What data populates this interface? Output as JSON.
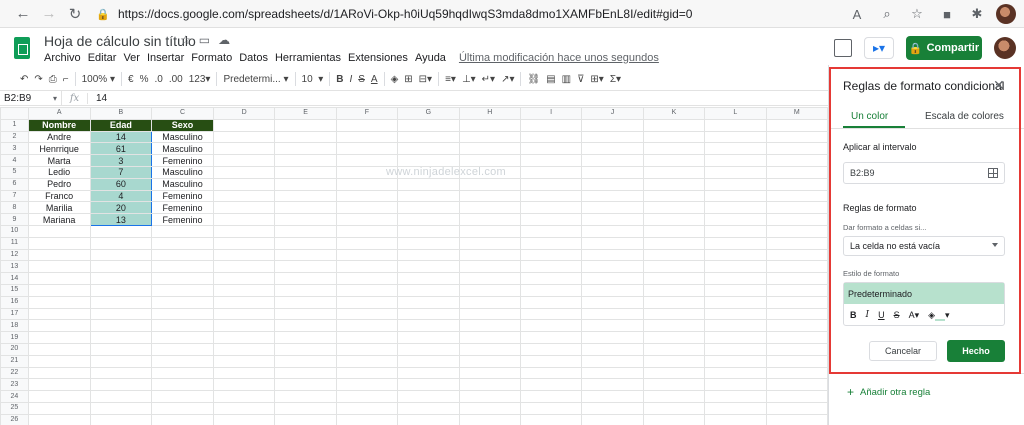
{
  "browser": {
    "url": "https://docs.google.com/spreadsheets/d/1ARoVi-Okp-h0iUq59hqdIwqS3mda8dmo1XAMFbEnL8I/edit#gid=0"
  },
  "doc": {
    "title": "Hoja de cálculo sin título",
    "menu": [
      "Archivo",
      "Editar",
      "Ver",
      "Insertar",
      "Formato",
      "Datos",
      "Herramientas",
      "Extensiones",
      "Ayuda"
    ],
    "last_modified": "Última modificación hace unos segundos",
    "share_label": "Compartir"
  },
  "toolbar": {
    "zoom": "100%",
    "currency": "€",
    "percent": "%",
    "dec_less": ".0",
    "dec_more": ".00",
    "format_more": "123",
    "font": "Predetermi...",
    "font_size": "10"
  },
  "formula_bar": {
    "name_box": "B2:B9",
    "fx": "fx",
    "value": "14"
  },
  "sheet": {
    "columns": [
      "A",
      "B",
      "C",
      "D",
      "E",
      "F",
      "G",
      "H",
      "I",
      "J",
      "K",
      "L",
      "M"
    ],
    "headers": [
      "Nombre",
      "Edad",
      "Sexo"
    ],
    "rows": [
      [
        "Andre",
        "14",
        "Masculino"
      ],
      [
        "Henrrique",
        "61",
        "Masculino"
      ],
      [
        "Marta",
        "3",
        "Femenino"
      ],
      [
        "Ledio",
        "7",
        "Masculino"
      ],
      [
        "Pedro",
        "60",
        "Masculino"
      ],
      [
        "Franco",
        "4",
        "Femenino"
      ],
      [
        "Marilia",
        "20",
        "Femenino"
      ],
      [
        "Mariana",
        "13",
        "Femenino"
      ]
    ],
    "total_rows": 26,
    "header_fill": "#274e13",
    "selection_fill": "#a8d8cf"
  },
  "watermark": "www.ninjadelexcel.com",
  "panel": {
    "title": "Reglas de formato condicional",
    "tab_one_color": "Un color",
    "tab_color_scale": "Escala de colores",
    "apply_range_label": "Aplicar al intervalo",
    "range_value": "B2:B9",
    "rules_label": "Reglas de formato",
    "condition_label": "Dar formato a celdas si...",
    "condition_value": "La celda no está vacía",
    "style_label": "Estilo de formato",
    "style_preview": "Predeterminado",
    "cancel_label": "Cancelar",
    "done_label": "Hecho",
    "add_rule_label": "Añadir otra regla",
    "accent_color": "#188038"
  }
}
